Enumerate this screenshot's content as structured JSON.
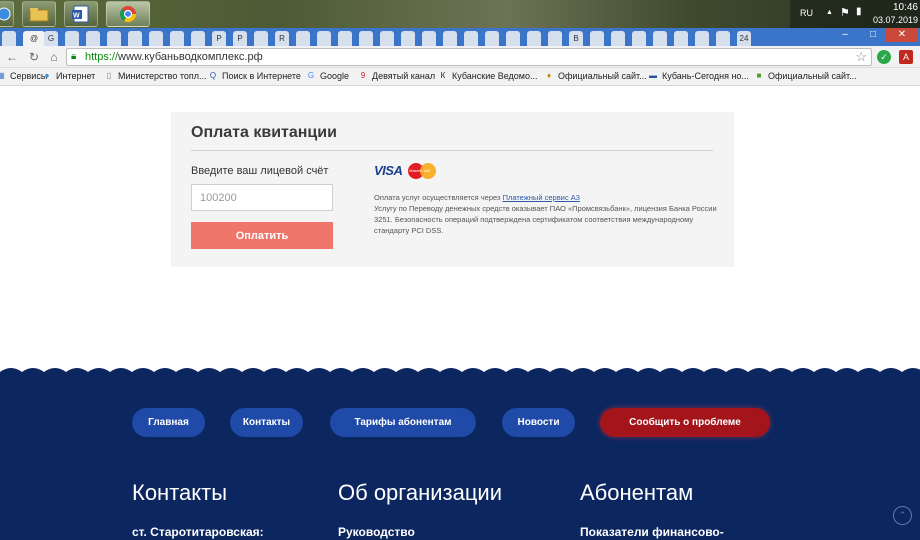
{
  "system_tray": {
    "language": "RU",
    "time": "10:46",
    "date": "03.07.2019"
  },
  "browser": {
    "url_scheme": "https://",
    "url_host": "www.кубаньводкомплекс.рф",
    "tabs": [
      "",
      "@",
      "G",
      "",
      "",
      "",
      "",
      "",
      "",
      "",
      "P",
      "P",
      "",
      "R",
      "",
      "",
      "",
      "",
      "",
      "",
      "",
      "",
      "",
      "",
      "",
      "",
      "",
      "B",
      "",
      "",
      "",
      "",
      "",
      "",
      "",
      "24"
    ],
    "bookmarks": [
      {
        "label": "Сервисы",
        "icon": "apps-icon"
      },
      {
        "label": "Интернет",
        "icon": "globe-icon"
      },
      {
        "label": "Министерство топл...",
        "icon": "page-icon"
      },
      {
        "label": "Поиск в Интернете",
        "icon": "search-icon"
      },
      {
        "label": "Google",
        "icon": "google-icon"
      },
      {
        "label": "Девятый канал",
        "icon": "channel-icon"
      },
      {
        "label": "Кубанские Ведомо...",
        "icon": "newspaper-icon"
      },
      {
        "label": "Официальный сайт...",
        "icon": "emblem-icon"
      },
      {
        "label": "Кубань-Сегодня но...",
        "icon": "news-icon"
      },
      {
        "label": "Официальный сайт...",
        "icon": "site-icon"
      }
    ]
  },
  "payment": {
    "title": "Оплата квитанции",
    "account_label": "Введите ваш лицевой счёт",
    "account_value": "100200",
    "pay_button": "Оплатить",
    "visa_label": "VISA",
    "mastercard_label": "MasterCard",
    "notice_prefix": "Оплата услуг осуществляется через ",
    "notice_link": "Платежный сервис А3",
    "notice_body": "Услугу по Переводу денежных средств оказывает ПАО «Промсвязьбанк», лицензия Банка России 3251. Безопасность операций подтверждена сертификатом соответствия международному стандарту PCI DSS."
  },
  "footer": {
    "nav": [
      "Главная",
      "Контакты",
      "Тарифы абонентам",
      "Новости"
    ],
    "report_button": "Сообщить о проблеме",
    "columns": [
      {
        "title": "Контакты",
        "first_item": "ст. Старотитаровская:"
      },
      {
        "title": "Об организации",
        "first_item": "Руководство"
      },
      {
        "title": "Абонентам",
        "first_item": "Показатели финансово-"
      }
    ]
  },
  "colors": {
    "footer_bg": "#0c2660",
    "pill_blue": "#1f4aa8",
    "pill_red": "#a3141b",
    "pay_button": "#f0766c"
  }
}
